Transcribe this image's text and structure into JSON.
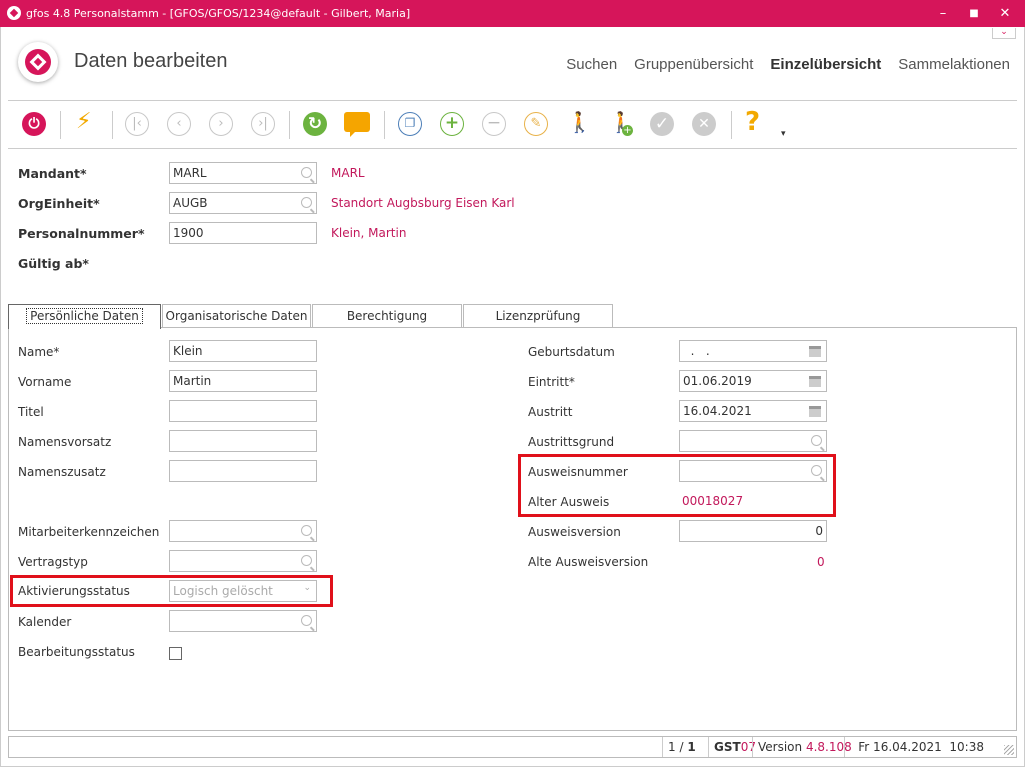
{
  "window": {
    "title": "gfos 4.8  Personalstamm - [GFOS/GFOS/1234@default - Gilbert, Maria]",
    "minimize": "–",
    "maximize": "■",
    "close": "✕"
  },
  "header": {
    "title": "Daten bearbeiten",
    "nav": [
      "Suchen",
      "Gruppenübersicht",
      "Einzelübersicht",
      "Sammelaktionen"
    ]
  },
  "toolbar": {
    "icons": [
      "power-icon",
      "lightning-icon",
      "first-record-icon",
      "previous-record-icon",
      "next-record-icon",
      "last-record-icon",
      "refresh-icon",
      "comment-icon",
      "copy-icon",
      "add-icon",
      "remove-icon",
      "edit-icon",
      "walk-minus-icon",
      "walk-plus-icon",
      "confirm-icon",
      "cancel-icon",
      "help-icon"
    ],
    "help": "?",
    "more": "▾"
  },
  "head_fields": {
    "mandant": {
      "label": "Mandant*",
      "value": "MARL",
      "desc": "MARL"
    },
    "orgeinheit": {
      "label": "OrgEinheit*",
      "value": "AUGB",
      "desc": "Standort Augbsburg Eisen Karl"
    },
    "personalnummer": {
      "label": "Personalnummer*",
      "value": "1900",
      "desc": "Klein, Martin"
    },
    "gueltig": {
      "label": "Gültig ab*"
    }
  },
  "tabs": [
    "Persönliche Daten",
    "Organisatorische Daten",
    "Berechtigung",
    "Lizenzprüfung"
  ],
  "left": {
    "name": {
      "label": "Name*",
      "value": "Klein"
    },
    "vorname": {
      "label": "Vorname",
      "value": "Martin"
    },
    "titel": {
      "label": "Titel",
      "value": ""
    },
    "namensvorsatz": {
      "label": "Namensvorsatz",
      "value": ""
    },
    "namenszusatz": {
      "label": "Namenszusatz",
      "value": ""
    },
    "mitarbeiterkennzeichen": {
      "label": "Mitarbeiterkennzeichen",
      "value": ""
    },
    "vertragstyp": {
      "label": "Vertragstyp",
      "value": ""
    },
    "aktivierungsstatus": {
      "label": "Aktivierungsstatus",
      "value": "Logisch gelöscht"
    },
    "kalender": {
      "label": "Kalender",
      "value": ""
    },
    "bearbeitungsstatus": {
      "label": "Bearbeitungsstatus",
      "checked": false
    }
  },
  "right": {
    "geburtsdatum": {
      "label": "Geburtsdatum",
      "value": "  .   ."
    },
    "eintritt": {
      "label": "Eintritt*",
      "value": "01.06.2019"
    },
    "austritt": {
      "label": "Austritt",
      "value": "16.04.2021"
    },
    "austrittsgrund": {
      "label": "Austrittsgrund",
      "value": ""
    },
    "ausweisnummer": {
      "label": "Ausweisnummer",
      "value": ""
    },
    "alter_ausweis": {
      "label": "Alter Ausweis",
      "value": "00018027"
    },
    "ausweisversion": {
      "label": "Ausweisversion",
      "value": "0"
    },
    "alte_ausweisversion": {
      "label": "Alte Ausweisversion",
      "value": "0"
    }
  },
  "status": {
    "page": "1 / ",
    "page_bold": "1",
    "gst": "GST",
    "gst_num": "07",
    "version_label": "Version",
    "version": "4.8.108",
    "date": "Fr 16.04.2021",
    "time": "10:38"
  },
  "colors": {
    "brand": "#d6155a",
    "highlight": "#e0101a",
    "value_red": "#c2185b"
  }
}
